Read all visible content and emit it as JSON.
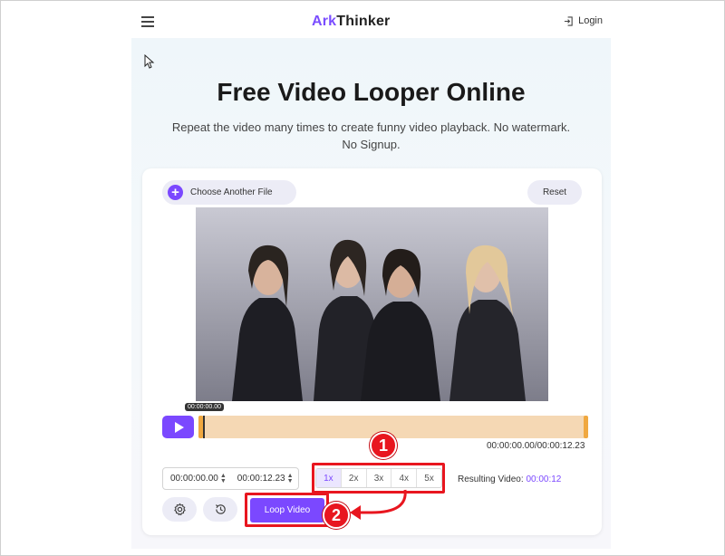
{
  "header": {
    "logo_ark": "Ark",
    "logo_thinker": "Thinker",
    "login_label": "Login"
  },
  "hero": {
    "title": "Free Video Looper Online",
    "subtitle": "Repeat the video many times to create funny video playback. No watermark. No Signup."
  },
  "editor": {
    "choose_file_label": "Choose Another File",
    "reset_label": "Reset",
    "playhead_time": "00:00:00.00",
    "duration_text": "00:00:00.00/00:00:12.23",
    "start_time": "00:00:00.00",
    "end_time": "00:00:12.23",
    "loop_options": [
      "1x",
      "2x",
      "3x",
      "4x",
      "5x"
    ],
    "selected_loop": "1x",
    "result_label": "Resulting Video:",
    "result_value": "00:00:12",
    "loop_button_label": "Loop Video"
  },
  "annotations": {
    "badge_1": "1",
    "badge_2": "2",
    "color": "#e8161f"
  },
  "colors": {
    "accent": "#7b48ff",
    "timeline": "#f5d8b4",
    "timeline_handle": "#f0a840"
  },
  "icons": [
    "menu-icon",
    "login-icon",
    "plus-icon",
    "play-icon",
    "settings-icon",
    "history-icon",
    "cursor-icon"
  ]
}
